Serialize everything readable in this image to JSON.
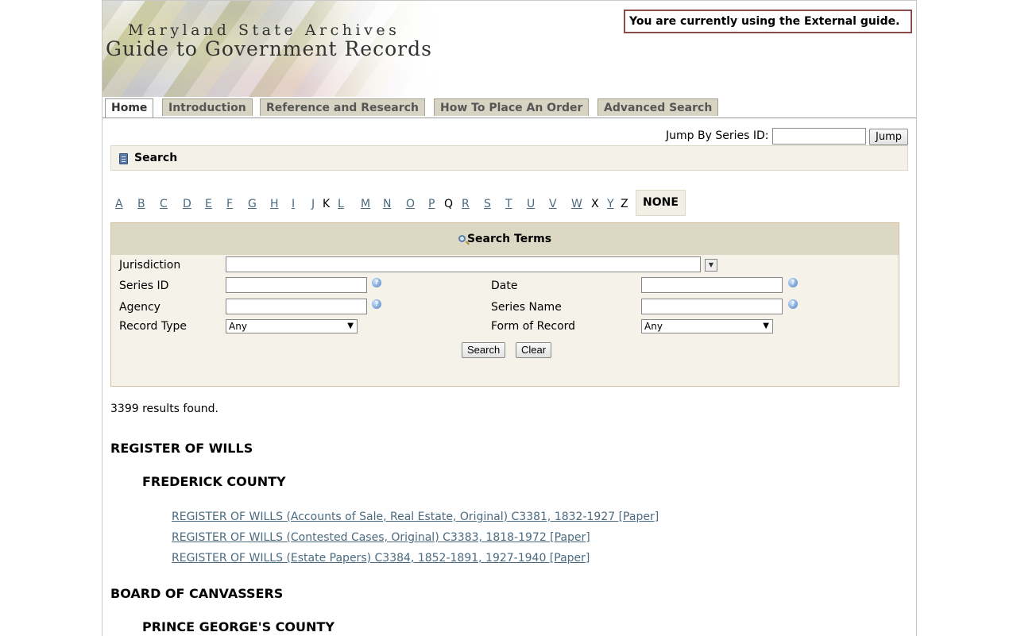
{
  "header": {
    "brand_line1": "Maryland State Archives",
    "brand_line2": "Guide to Government Records",
    "guide_notice": "You are currently using the External guide."
  },
  "tabs": [
    {
      "label": "Home",
      "active": true
    },
    {
      "label": "Introduction",
      "active": false
    },
    {
      "label": "Reference and Research",
      "active": false
    },
    {
      "label": "How To Place An Order",
      "active": false
    },
    {
      "label": "Advanced Search",
      "active": false
    }
  ],
  "jump": {
    "label": "Jump By Series ID:",
    "input_value": "",
    "button_label": "Jump"
  },
  "search_bar": {
    "title": "Search",
    "icon": "book-icon"
  },
  "alphabet": {
    "letters": [
      {
        "letter": "A",
        "link": true
      },
      {
        "letter": "B",
        "link": true
      },
      {
        "letter": "C",
        "link": true
      },
      {
        "letter": "D",
        "link": true
      },
      {
        "letter": "E",
        "link": true
      },
      {
        "letter": "F",
        "link": true
      },
      {
        "letter": "G",
        "link": true
      },
      {
        "letter": "H",
        "link": true
      },
      {
        "letter": "I",
        "link": true
      },
      {
        "letter": "J",
        "link": true
      },
      {
        "letter": "K",
        "link": false
      },
      {
        "letter": "L",
        "link": true
      },
      {
        "letter": "M",
        "link": true
      },
      {
        "letter": "N",
        "link": true
      },
      {
        "letter": "O",
        "link": true
      },
      {
        "letter": "P",
        "link": true
      },
      {
        "letter": "Q",
        "link": false
      },
      {
        "letter": "R",
        "link": true
      },
      {
        "letter": "S",
        "link": true
      },
      {
        "letter": "T",
        "link": true
      },
      {
        "letter": "U",
        "link": true
      },
      {
        "letter": "V",
        "link": true
      },
      {
        "letter": "W",
        "link": true
      },
      {
        "letter": "X",
        "link": false
      },
      {
        "letter": "Y",
        "link": true
      },
      {
        "letter": "Z",
        "link": false
      }
    ],
    "none_label": "NONE"
  },
  "search_terms": {
    "title": "Search Terms",
    "jurisdiction_label": "Jurisdiction",
    "jurisdiction_value": "",
    "series_id_label": "Series ID",
    "series_id_value": "",
    "date_label": "Date",
    "date_value": "",
    "agency_label": "Agency",
    "agency_value": "",
    "series_name_label": "Series Name",
    "series_name_value": "",
    "record_type_label": "Record Type",
    "record_type_value": "Any",
    "form_label": "Form of Record",
    "form_value": "Any",
    "search_button": "Search",
    "clear_button": "Clear"
  },
  "results": {
    "count_text": "3399 results found.",
    "groups": [
      {
        "name": "REGISTER OF WILLS",
        "county": "FREDERICK COUNTY",
        "records": [
          "REGISTER OF WILLS (Accounts of Sale, Real Estate, Original) C3381, 1832-1927 [Paper]",
          "REGISTER OF WILLS (Contested Cases, Original) C3383, 1818-1972 [Paper]",
          "REGISTER OF WILLS (Estate Papers) C3384, 1852-1891, 1927-1940 [Paper]"
        ]
      },
      {
        "name": "BOARD OF CANVASSERS",
        "county": "PRINCE GEORGE'S COUNTY",
        "records": []
      }
    ]
  }
}
